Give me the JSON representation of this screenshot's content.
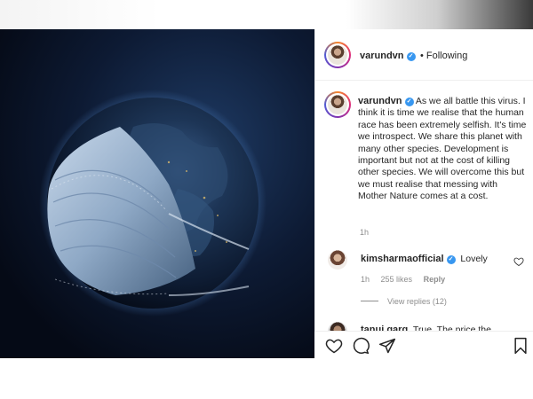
{
  "post": {
    "username": "varundvn",
    "follow_separator": "•",
    "follow_status": "Following",
    "caption_username": "varundvn",
    "caption": "As we all battle this virus. I think it is time we realise that the human race has been extremely selfish. It's time we introspect. We share this planet with many other species. Development is important but not at the cost of killing other species. We will overcome this but we must realise that messing with Mother Nature comes at a cost.",
    "time": "1h"
  },
  "comments": [
    {
      "username": "kimsharmaofficial",
      "text": "Lovely",
      "time": "1h",
      "likes": "255 likes",
      "reply_label": "Reply",
      "view_replies": "View replies (12)"
    },
    {
      "username": "tanuj.garg",
      "text": "True. The price the"
    }
  ],
  "icons": {
    "verified": "verified-badge-icon",
    "like": "heart-icon",
    "comment": "comment-icon",
    "share": "share-icon",
    "save": "bookmark-icon"
  },
  "colors": {
    "verified": "#3897f0",
    "text": "#262626",
    "muted": "#8e8e8e"
  }
}
